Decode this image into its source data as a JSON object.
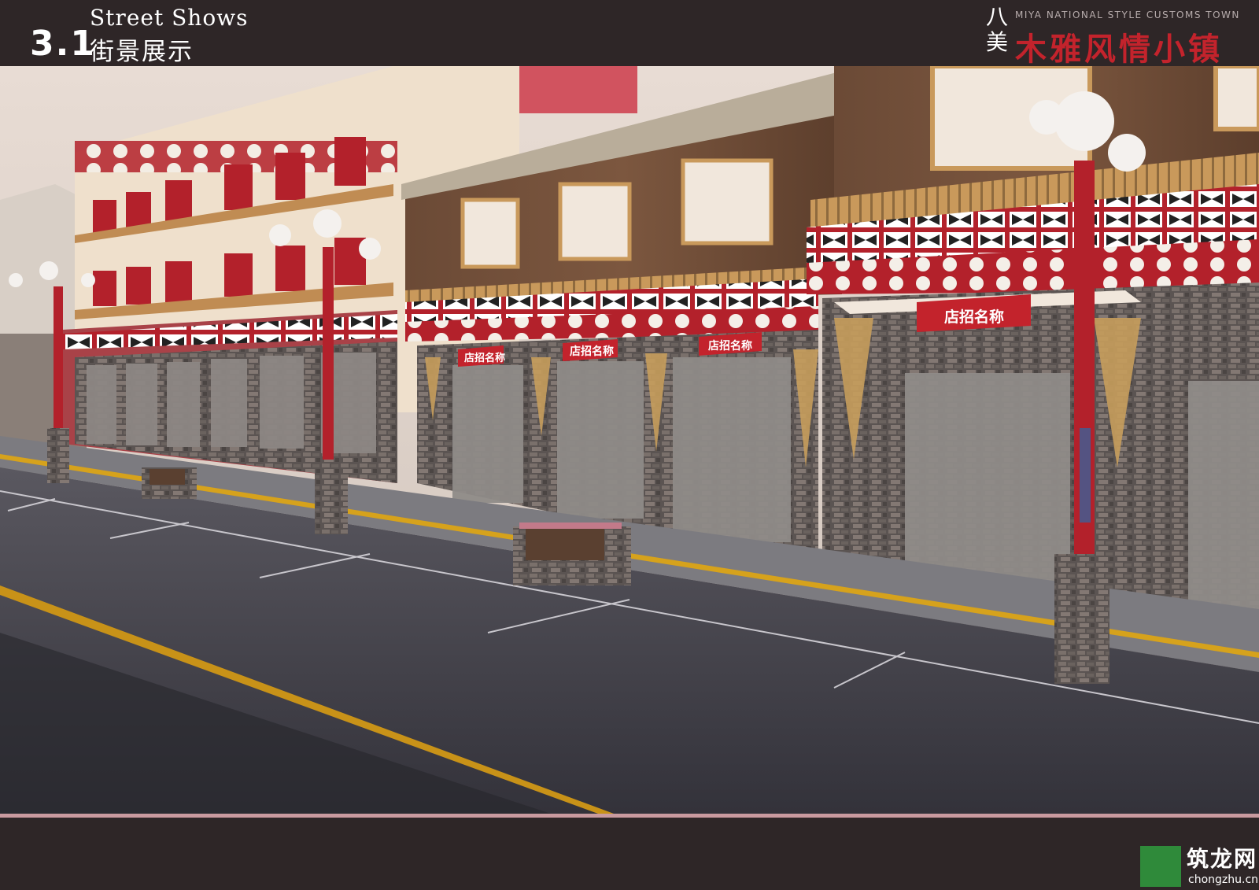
{
  "header": {
    "section_number": "3.1",
    "title_en": "Street Shows",
    "title_cn": "街景展示"
  },
  "brand": {
    "mark": "八美",
    "subtitle_en": "MIYA NATIONAL STYLE CUSTOMS TOWN",
    "title_cn": "木雅风情小镇"
  },
  "shop_signs": [
    "店招名称",
    "店招名称",
    "店招名称",
    "店招名称"
  ],
  "watermark": {
    "text": "筑龙网",
    "url": "chongzhu.cn"
  },
  "colors": {
    "bar": "#2e2627",
    "accent_red": "#c3232c",
    "pink_rule": "#c99a9f",
    "watermark_green": "#2f8a3a"
  }
}
